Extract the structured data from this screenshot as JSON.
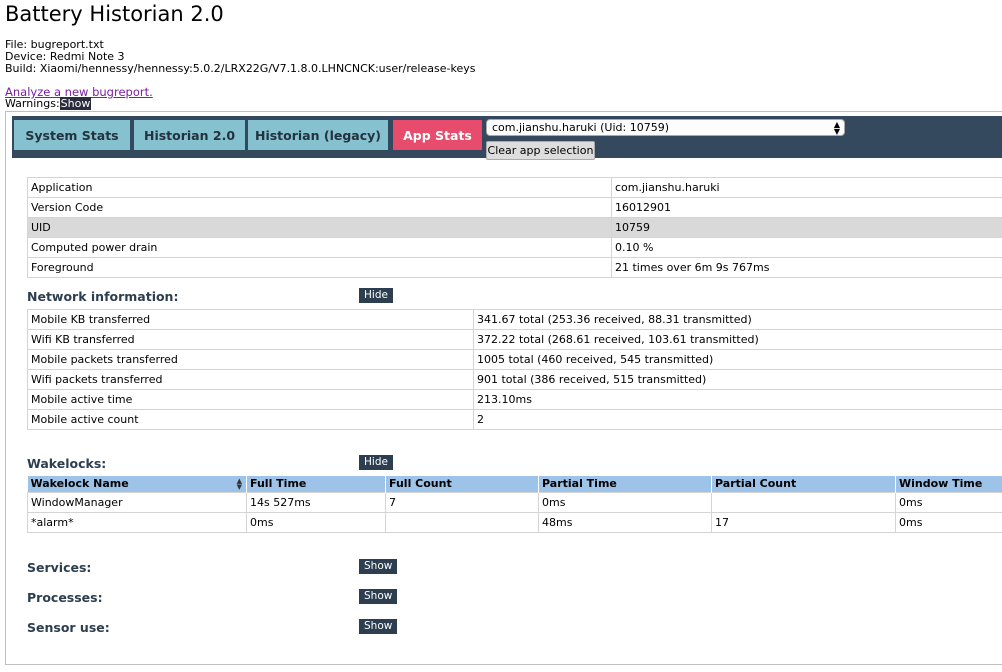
{
  "page": {
    "title": "Battery Historian 2.0",
    "file_line": "File: bugreport.txt",
    "device_line": "Device: Redmi Note 3",
    "build_line": "Build: Xiaomi/hennessy/hennessy:5.0.2/LRX22G/V7.1.8.0.LHNCNCK:user/release-keys",
    "analyze_link": "Analyze a new bugreport.",
    "warnings_label": "Warnings:",
    "warnings_show": "Show"
  },
  "tabs": {
    "system_stats": "System Stats",
    "historian_2": "Historian 2.0",
    "historian_legacy": "Historian (legacy)",
    "app_stats": "App Stats",
    "active_color": "#e74c6c",
    "inactive_color": "#85c1cf",
    "bar_color": "#34495e"
  },
  "app_selector": {
    "selected": "com.jianshu.haruki (Uid: 10759)",
    "clear_button": "Clear app selection"
  },
  "app_info": {
    "rows": [
      {
        "label": "Application",
        "value": "com.jianshu.haruki"
      },
      {
        "label": "Version Code",
        "value": "16012901"
      },
      {
        "label": "UID",
        "value": "10759"
      },
      {
        "label": "Computed power drain",
        "value": "0.10 %"
      },
      {
        "label": "Foreground",
        "value": "21 times over 6m 9s 767ms"
      }
    ]
  },
  "network": {
    "title": "Network information:",
    "button": "Hide",
    "rows": [
      {
        "label": "Mobile KB transferred",
        "value": "341.67 total (253.36 received, 88.31 transmitted)"
      },
      {
        "label": "Wifi KB transferred",
        "value": "372.22 total (268.61 received, 103.61 transmitted)"
      },
      {
        "label": "Mobile packets transferred",
        "value": "1005 total (460 received, 545 transmitted)"
      },
      {
        "label": "Wifi packets transferred",
        "value": "901 total (386 received, 515 transmitted)"
      },
      {
        "label": "Mobile active time",
        "value": "213.10ms"
      },
      {
        "label": "Mobile active count",
        "value": "2"
      }
    ]
  },
  "wakelocks": {
    "title": "Wakelocks:",
    "button": "Hide",
    "headers": [
      "Wakelock Name",
      "Full Time",
      "Full Count",
      "Partial Time",
      "Partial Count",
      "Window Time"
    ],
    "rows": [
      [
        "WindowManager",
        "14s 527ms",
        "7",
        "0ms",
        "",
        "0ms"
      ],
      [
        "*alarm*",
        "0ms",
        "",
        "48ms",
        "17",
        "0ms"
      ]
    ]
  },
  "services": {
    "title": "Services:",
    "button": "Show"
  },
  "processes": {
    "title": "Processes:",
    "button": "Show"
  },
  "sensors": {
    "title": "Sensor use:",
    "button": "Show"
  }
}
